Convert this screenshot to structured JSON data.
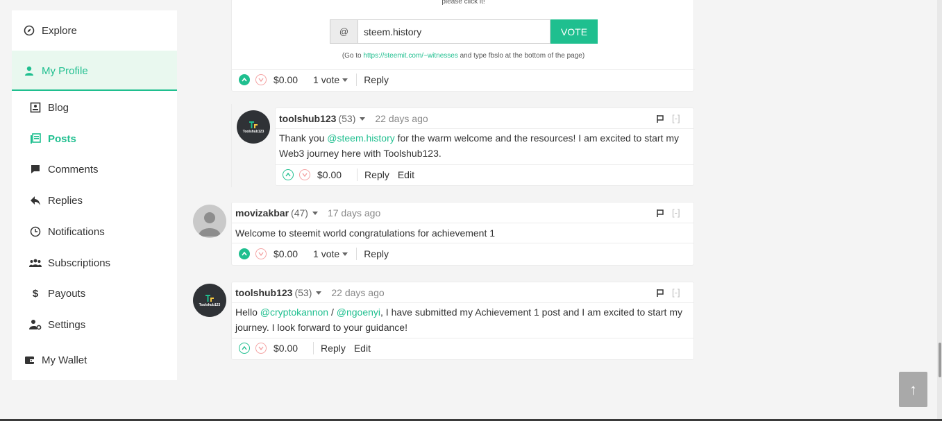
{
  "sidebar": {
    "explore": "Explore",
    "my_profile": "My Profile",
    "items": [
      {
        "label": "Blog"
      },
      {
        "label": "Posts"
      },
      {
        "label": "Comments"
      },
      {
        "label": "Replies"
      },
      {
        "label": "Notifications"
      },
      {
        "label": "Subscriptions"
      },
      {
        "label": "Payouts"
      },
      {
        "label": "Settings"
      }
    ],
    "wallet": "My Wallet"
  },
  "witness_card": {
    "top_note": "please click it!",
    "at_symbol": "@",
    "input_value": "steem.history",
    "vote_button": "VOTE",
    "goto_prefix": "(Go to ",
    "goto_link": "https://steemit.com/~witnesses",
    "goto_suffix": " and type fbslo at the bottom of the page)",
    "payout": "$0.00",
    "votes": "1 vote",
    "reply": "Reply"
  },
  "comments": [
    {
      "author": "toolshub123",
      "rep": "(53)",
      "age": "22 days ago",
      "collapse": "[-]",
      "avatar_text": "Toolshub123",
      "body_1": "Thank you ",
      "mention_1": "@steem.history",
      "body_2": " for the warm welcome and the resources! I am excited to start my Web3 journey here with Toolshub123.",
      "payout": "$0.00",
      "reply": "Reply",
      "edit": "Edit"
    },
    {
      "author": "movizakbar",
      "rep": "(47)",
      "age": "17 days ago",
      "collapse": "[-]",
      "body": "Welcome to steemit world congratulations for achievement 1",
      "payout": "$0.00",
      "votes": "1 vote",
      "reply": "Reply"
    },
    {
      "author": "toolshub123",
      "rep": "(53)",
      "age": "22 days ago",
      "collapse": "[-]",
      "avatar_text": "Toolshub123",
      "body_1": "Hello ",
      "mention_1": "@cryptokannon",
      "body_2": " / ",
      "mention_2": "@ngoenyi",
      "body_3": ", I have submitted my Achievement 1 post and I am excited to start my journey. I look forward to your guidance!",
      "payout": "$0.00",
      "reply": "Reply",
      "edit": "Edit"
    }
  ],
  "scroll_top": "↑",
  "colors": {
    "accent": "#1fbf8f",
    "downvote": "#f4a3a3",
    "profile_bg": "#e9f8ef"
  }
}
